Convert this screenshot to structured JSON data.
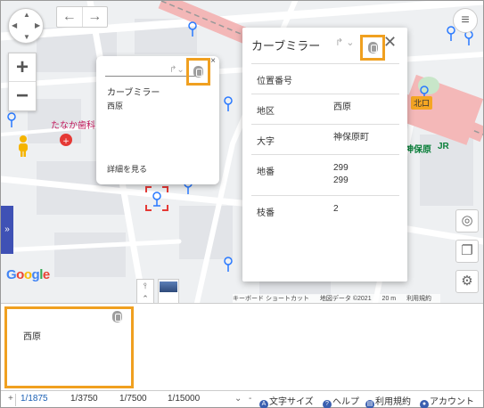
{
  "map": {
    "poi_label": "たなか歯科",
    "station_label": "神保原",
    "station_mark": "JR",
    "exit_label": "北口",
    "logo_text": "Google",
    "attribution": [
      "キーボード ショートカット",
      "地図データ ©2021",
      "20 m",
      "利用規約"
    ],
    "side_tab_glyph": "»"
  },
  "popup_small": {
    "title": "カーブミラー",
    "subtitle": "西原",
    "more_link": "詳細を見る",
    "close_glyph": "×"
  },
  "popup_big": {
    "title": "カーブミラー",
    "close_glyph": "✕",
    "rows": [
      {
        "key": "位置番号",
        "value": ""
      },
      {
        "key": "地区",
        "value": "西原"
      },
      {
        "key": "大字",
        "value": "神保原町"
      },
      {
        "key": "地番",
        "value": "299\n299"
      },
      {
        "key": "枝番",
        "value": "2"
      }
    ]
  },
  "bottom_panel": {
    "text": "西原"
  },
  "statusbar": {
    "plus": "+",
    "scales": [
      "1/1875",
      "1/3750",
      "1/7500",
      "1/15000"
    ],
    "minus": "-",
    "links": [
      {
        "icon": "A",
        "label": "文字サイズ"
      },
      {
        "icon": "?",
        "label": "ヘルプ"
      },
      {
        "icon": "▤",
        "label": "利用規約"
      },
      {
        "icon": "●",
        "label": "アカウント"
      }
    ]
  },
  "colors": {
    "accent": "#f0a020",
    "link": "#1a5fb4",
    "station": "#0a7f3a",
    "poi": "#c2185b"
  }
}
